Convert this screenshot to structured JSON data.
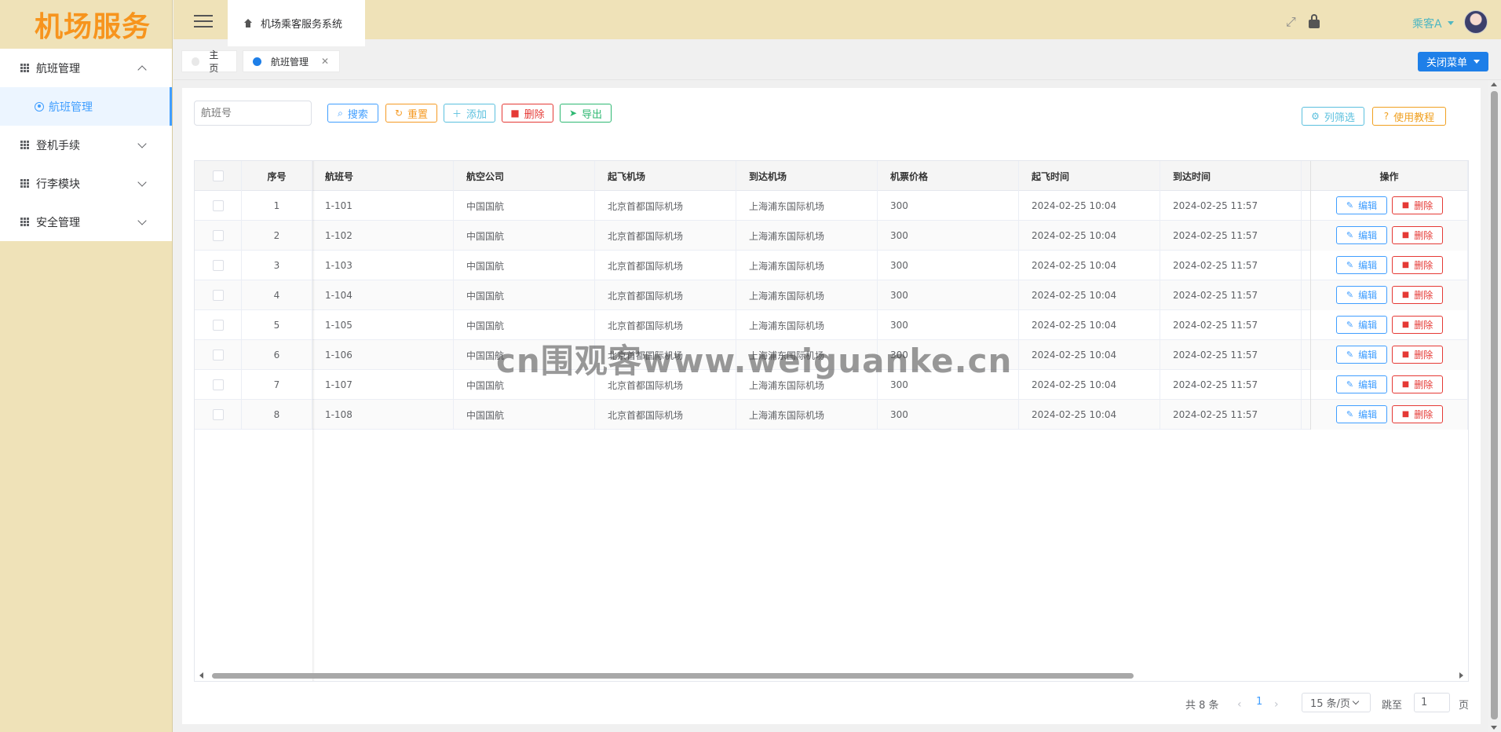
{
  "app": {
    "logo": "机场服务",
    "system_title": "机场乘客服务系统"
  },
  "header": {
    "user_name": "乘客A"
  },
  "sidebar": {
    "items": [
      {
        "label": "航班管理",
        "expanded": true,
        "children": [
          {
            "label": "航班管理",
            "active": true
          }
        ]
      },
      {
        "label": "登机手续",
        "expanded": false
      },
      {
        "label": "行李模块",
        "expanded": false
      },
      {
        "label": "安全管理",
        "expanded": false
      }
    ]
  },
  "tags": {
    "home_label": "主页",
    "active_label": "航班管理",
    "close_menu_label": "关闭菜单"
  },
  "toolbar": {
    "search_placeholder": "航班号",
    "search_label": "搜索",
    "reset_label": "重置",
    "add_label": "添加",
    "delete_label": "删除",
    "export_label": "导出",
    "column_filter_label": "列筛选",
    "tutorial_label": "使用教程"
  },
  "table": {
    "columns": [
      "序号",
      "航班号",
      "航空公司",
      "起飞机场",
      "到达机场",
      "机票价格",
      "起飞时间",
      "到达时间",
      "操作"
    ],
    "edit_label": "编辑",
    "delete_label": "删除",
    "rows": [
      {
        "idx": "1",
        "flight": "1-101",
        "airline": "中国国航",
        "from": "北京首都国际机场",
        "to": "上海浦东国际机场",
        "price": "300",
        "dep": "2024-02-25 10:04",
        "arr": "2024-02-25 11:57"
      },
      {
        "idx": "2",
        "flight": "1-102",
        "airline": "中国国航",
        "from": "北京首都国际机场",
        "to": "上海浦东国际机场",
        "price": "300",
        "dep": "2024-02-25 10:04",
        "arr": "2024-02-25 11:57"
      },
      {
        "idx": "3",
        "flight": "1-103",
        "airline": "中国国航",
        "from": "北京首都国际机场",
        "to": "上海浦东国际机场",
        "price": "300",
        "dep": "2024-02-25 10:04",
        "arr": "2024-02-25 11:57"
      },
      {
        "idx": "4",
        "flight": "1-104",
        "airline": "中国国航",
        "from": "北京首都国际机场",
        "to": "上海浦东国际机场",
        "price": "300",
        "dep": "2024-02-25 10:04",
        "arr": "2024-02-25 11:57"
      },
      {
        "idx": "5",
        "flight": "1-105",
        "airline": "中国国航",
        "from": "北京首都国际机场",
        "to": "上海浦东国际机场",
        "price": "300",
        "dep": "2024-02-25 10:04",
        "arr": "2024-02-25 11:57"
      },
      {
        "idx": "6",
        "flight": "1-106",
        "airline": "中国国航",
        "from": "北京首都国际机场",
        "to": "上海浦东国际机场",
        "price": "300",
        "dep": "2024-02-25 10:04",
        "arr": "2024-02-25 11:57"
      },
      {
        "idx": "7",
        "flight": "1-107",
        "airline": "中国国航",
        "from": "北京首都国际机场",
        "to": "上海浦东国际机场",
        "price": "300",
        "dep": "2024-02-25 10:04",
        "arr": "2024-02-25 11:57"
      },
      {
        "idx": "8",
        "flight": "1-108",
        "airline": "中国国航",
        "from": "北京首都国际机场",
        "to": "上海浦东国际机场",
        "price": "300",
        "dep": "2024-02-25 10:04",
        "arr": "2024-02-25 11:57"
      }
    ]
  },
  "pagination": {
    "total_text": "共 8 条",
    "current_page": "1",
    "page_size": "15 条/页",
    "jump_prefix": "跳至",
    "jump_value": "1",
    "jump_suffix": "页"
  },
  "watermark": "cn围观客www.weiguanke.cn",
  "colors": {
    "accent": "#409eff",
    "header_bg": "#efe2b8",
    "logo": "#f7941d",
    "primary_button": "#1e7fe8"
  }
}
